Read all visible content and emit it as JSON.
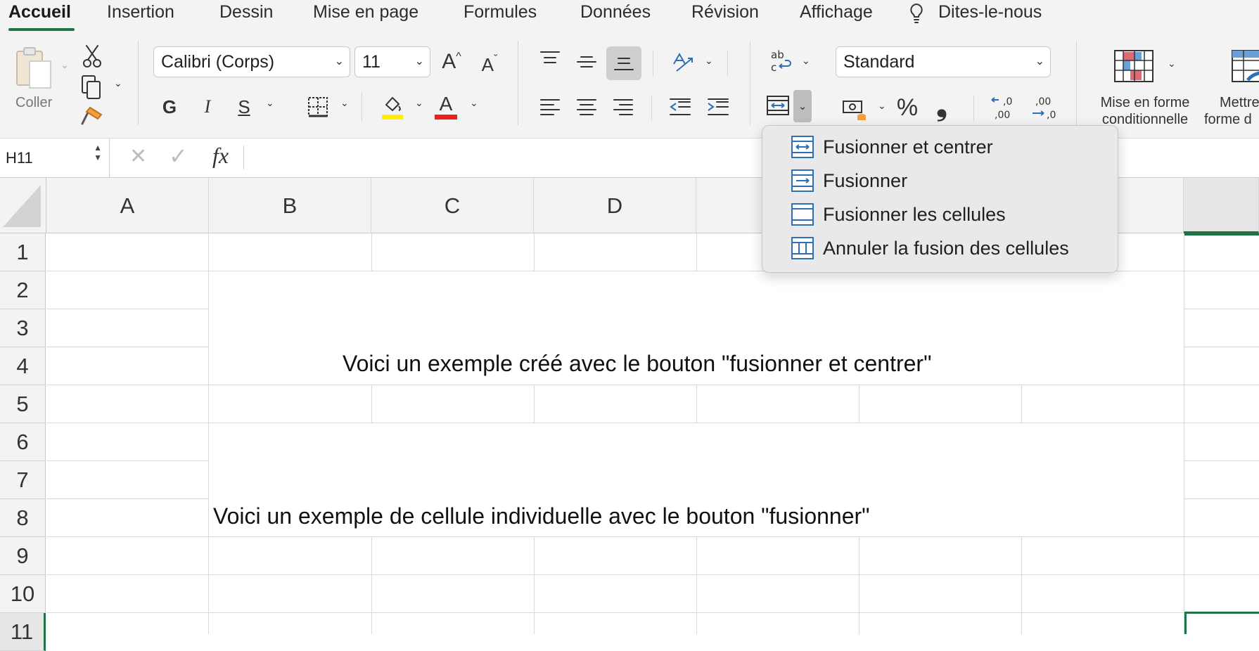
{
  "ribbon": {
    "tabs": [
      "Accueil",
      "Insertion",
      "Dessin",
      "Mise en page",
      "Formules",
      "Données",
      "Révision",
      "Affichage",
      "Dites-le-nous"
    ],
    "active_tab": "Accueil",
    "paste_label": "Coller",
    "font_name": "Calibri (Corps)",
    "font_size": "11",
    "grow_font": "A",
    "shrink_font": "A",
    "bold": "G",
    "italic": "I",
    "underline": "S",
    "font_color_glyph": "A",
    "number_format": "Standard",
    "percent": "%",
    "comma": "❟",
    "cond_format_label_1": "Mise en forme",
    "cond_format_label_2": "conditionnelle",
    "table_format_label_1": "Mettre",
    "table_format_label_2": "forme d",
    "colors": {
      "accent": "#217346",
      "highlight": "#ffee00",
      "font_red": "#e8231d",
      "blue_icon": "#2f6fb5"
    }
  },
  "formula_bar": {
    "cell_ref": "H11",
    "cancel": "✕",
    "confirm": "✓",
    "fx": "fx",
    "value": ""
  },
  "grid": {
    "columns": [
      "A",
      "B",
      "C",
      "D"
    ],
    "rows": [
      "1",
      "2",
      "3",
      "4",
      "5",
      "6",
      "7",
      "8",
      "9",
      "10",
      "11"
    ],
    "merge_center_text": "Voici un exemple  créé avec le bouton \"fusionner et centrer\"",
    "merge_text": "Voici un exemple de cellule individuelle avec le bouton \"fusionner\""
  },
  "merge_menu": {
    "items": [
      {
        "label": "Fusionner et centrer",
        "icon": "merge-center-icon"
      },
      {
        "label": "Fusionner",
        "icon": "merge-across-icon"
      },
      {
        "label": "Fusionner les cellules",
        "icon": "merge-cells-icon"
      },
      {
        "label": "Annuler la fusion des cellules",
        "icon": "unmerge-cells-icon"
      }
    ]
  }
}
